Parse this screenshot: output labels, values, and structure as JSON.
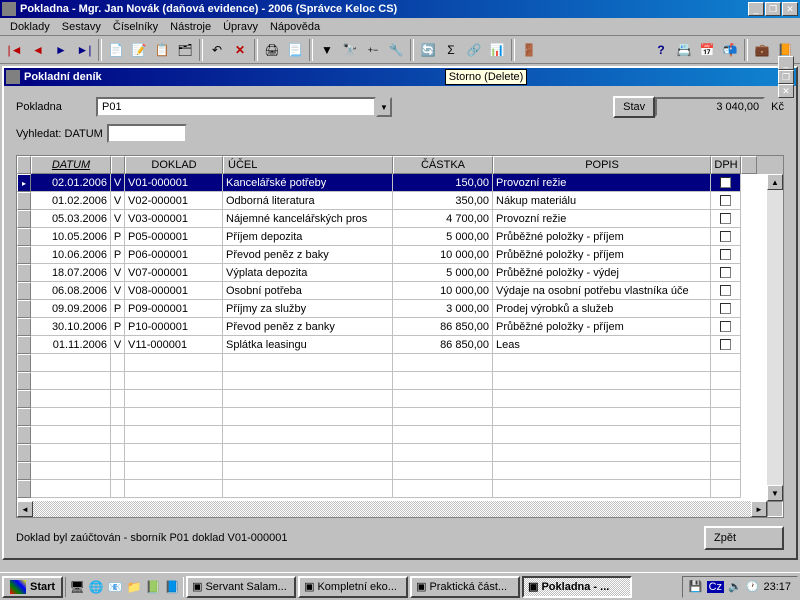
{
  "window": {
    "title": "Pokladna - Mgr. Jan Novák (daňová evidence) - 2006 (Správce Keloc CS)"
  },
  "menu": [
    "Doklady",
    "Sestavy",
    "Číselníky",
    "Nástroje",
    "Úpravy",
    "Nápověda"
  ],
  "subwindow": {
    "title": "Pokladní deník",
    "tooltip": "Storno (Delete)"
  },
  "form": {
    "pokladna_label": "Pokladna",
    "pokladna_value": "P01",
    "stav_label": "Stav",
    "stav_value": "3 040,00",
    "currency": "Kč",
    "vyhledat_label": "Vyhledat: DATUM"
  },
  "columns": [
    "DATUM",
    "",
    "DOKLAD",
    "ÚČEL",
    "ČÁSTKA",
    "POPIS",
    "DPH"
  ],
  "datum_sorted": true,
  "rows": [
    {
      "datum": "02.01.2006",
      "typ": "V",
      "doklad": "V01-000001",
      "ucel": "Kancelářské potřeby",
      "castka": "150,00",
      "popis": "Provozní režie",
      "sel": true
    },
    {
      "datum": "01.02.2006",
      "typ": "V",
      "doklad": "V02-000001",
      "ucel": "Odborná literatura",
      "castka": "350,00",
      "popis": "Nákup materiálu"
    },
    {
      "datum": "05.03.2006",
      "typ": "V",
      "doklad": "V03-000001",
      "ucel": "Nájemné kancelářských pros",
      "castka": "4 700,00",
      "popis": "Provozní režie"
    },
    {
      "datum": "10.05.2006",
      "typ": "P",
      "doklad": "P05-000001",
      "ucel": "Příjem depozita",
      "castka": "5 000,00",
      "popis": "Průběžné položky - příjem"
    },
    {
      "datum": "10.06.2006",
      "typ": "P",
      "doklad": "P06-000001",
      "ucel": "Převod peněz z baky",
      "castka": "10 000,00",
      "popis": "Průběžné položky - příjem"
    },
    {
      "datum": "18.07.2006",
      "typ": "V",
      "doklad": "V07-000001",
      "ucel": "Výplata depozita",
      "castka": "5 000,00",
      "popis": "Průběžné položky - výdej"
    },
    {
      "datum": "06.08.2006",
      "typ": "V",
      "doklad": "V08-000001",
      "ucel": "Osobní potřeba",
      "castka": "10 000,00",
      "popis": "Výdaje na osobní potřebu vlastníka úče"
    },
    {
      "datum": "09.09.2006",
      "typ": "P",
      "doklad": "P09-000001",
      "ucel": "Příjmy za služby",
      "castka": "3 000,00",
      "popis": "Prodej výrobků a služeb"
    },
    {
      "datum": "30.10.2006",
      "typ": "P",
      "doklad": "P10-000001",
      "ucel": "Převod peněz z banky",
      "castka": "86 850,00",
      "popis": "Průběžné položky - příjem"
    },
    {
      "datum": "01.11.2006",
      "typ": "V",
      "doklad": "V11-000001",
      "ucel": "Splátka leasingu",
      "castka": "86 850,00",
      "popis": "Leas"
    }
  ],
  "status": "Doklad byl zaúčtován - sborník P01 doklad V01-000001",
  "buttons": {
    "zpet": "Zpět"
  },
  "taskbar": {
    "start": "Start",
    "tasks": [
      {
        "label": "Servant Salam..."
      },
      {
        "label": "Kompletní eko..."
      },
      {
        "label": "Praktická část..."
      },
      {
        "label": "Pokladna - ...",
        "active": true
      }
    ],
    "tray_lang": "Cz",
    "clock": "23:17"
  }
}
